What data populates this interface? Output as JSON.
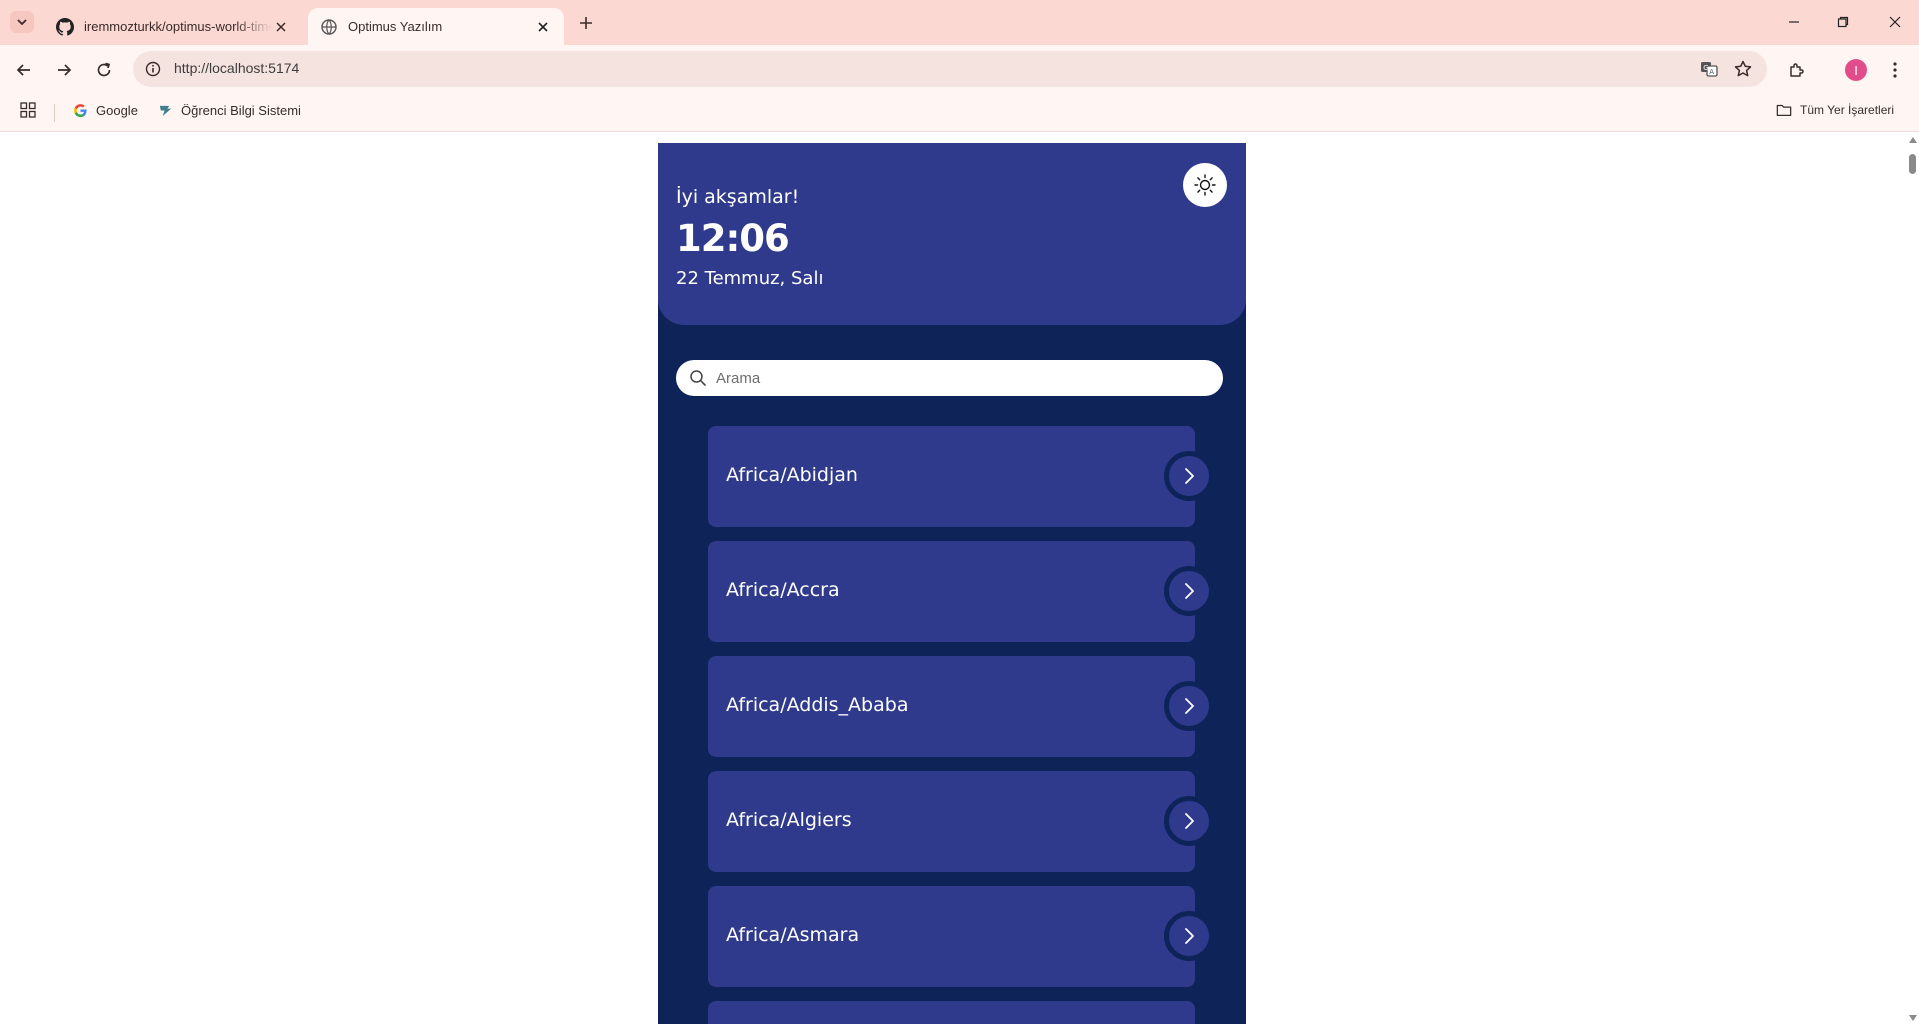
{
  "browser": {
    "tabs": [
      {
        "title": "iremmozturkk/optimus-world-time",
        "active": false,
        "favicon": "github-icon"
      },
      {
        "title": "Optimus Yazılım",
        "active": true,
        "favicon": "globe-icon"
      }
    ],
    "address": "http://localhost:5174",
    "avatar_letter": "I",
    "bookmarks": [
      {
        "label": "Google",
        "icon": "google-icon"
      },
      {
        "label": "Öğrenci Bilgi Sistemi",
        "icon": "school-icon"
      }
    ],
    "all_bookmarks_label": "Tüm Yer İşaretleri"
  },
  "app": {
    "greeting": "İyi akşamlar!",
    "time": "12:06",
    "date": "22 Temmuz, Salı",
    "search_placeholder": "Arama",
    "timezones": [
      {
        "name": "Africa/Abidjan"
      },
      {
        "name": "Africa/Accra"
      },
      {
        "name": "Africa/Addis_Ababa"
      },
      {
        "name": "Africa/Algiers"
      },
      {
        "name": "Africa/Asmara"
      }
    ]
  },
  "colors": {
    "app_background": "#0e2459",
    "card": "#2f3a8c",
    "chrome_tabbar": "#fbd8d2",
    "chrome_toolbar": "#fff6f4"
  }
}
